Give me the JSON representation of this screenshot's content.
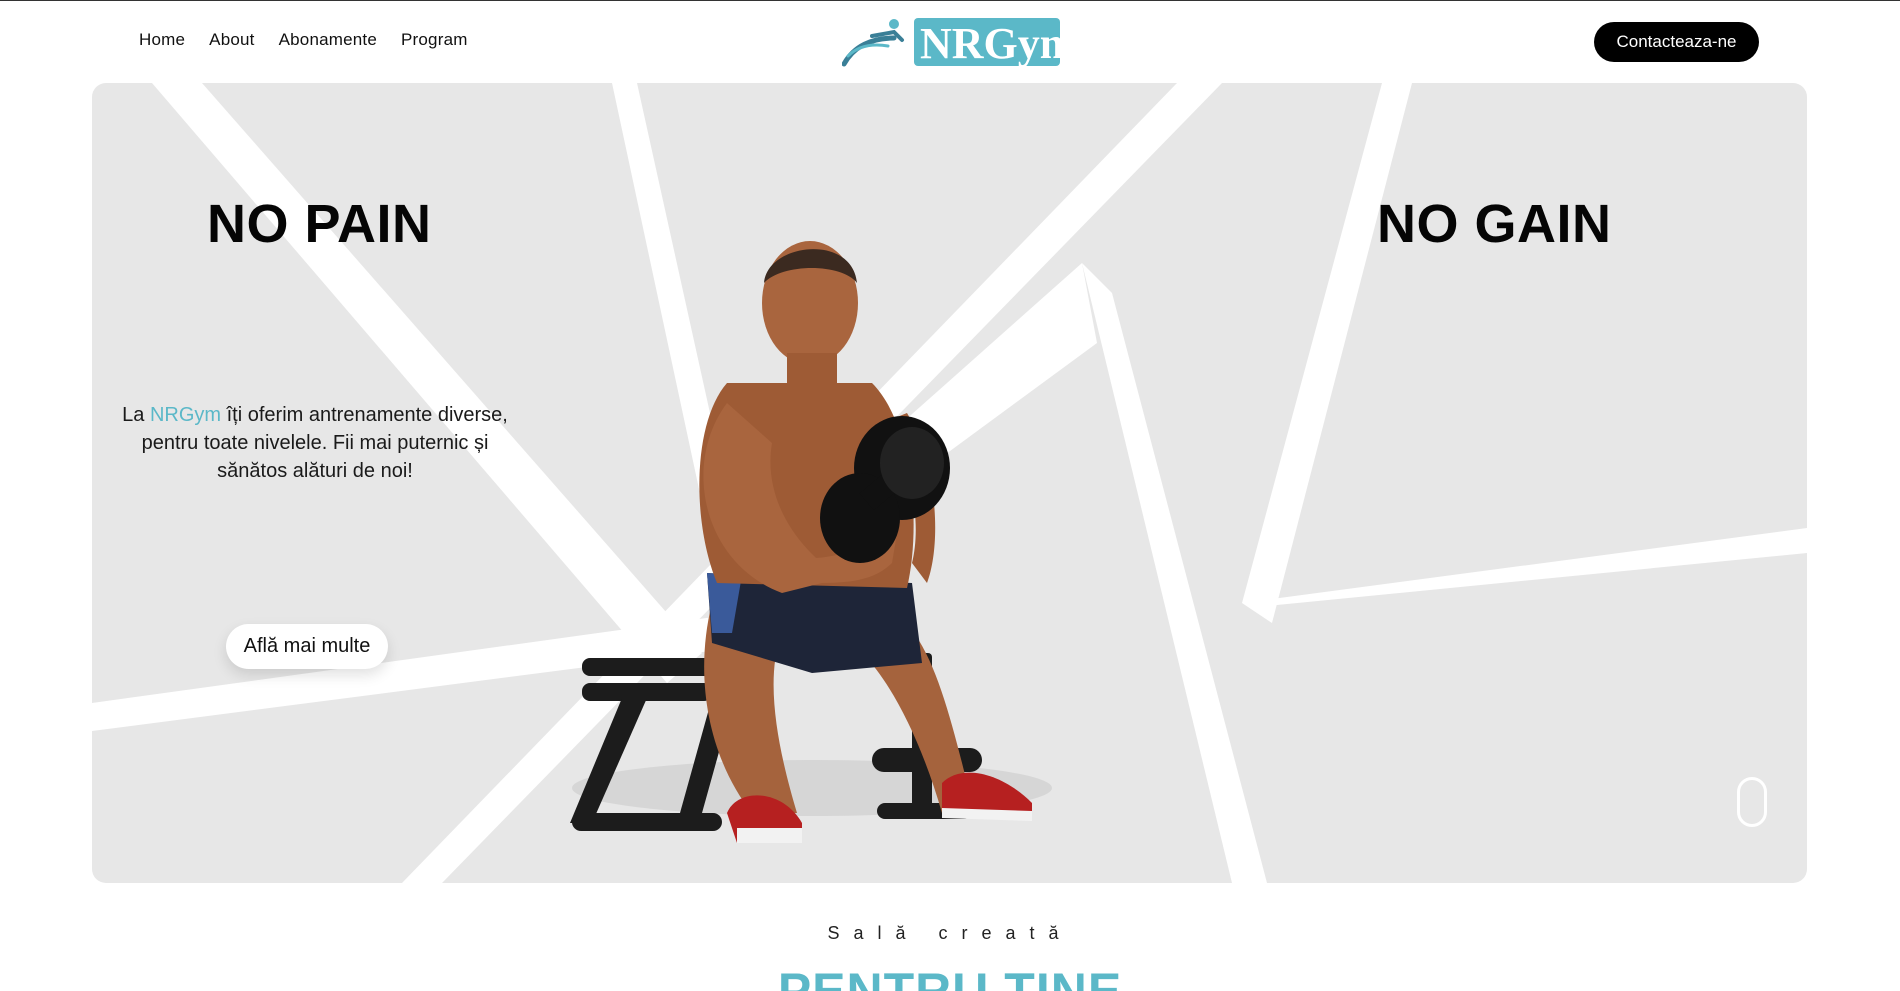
{
  "nav": {
    "links": [
      "Home",
      "About",
      "Abonamente",
      "Program"
    ],
    "logo_text": "NRGym",
    "cta_label": "Contacteaza-ne"
  },
  "hero": {
    "title_left": "NO PAIN",
    "title_right": "NO GAIN",
    "text_prefix": "La ",
    "text_brand": "NRGym",
    "text_rest": " îți oferim antrenamente diverse, pentru toate nivelele. Fii mai puternic și sănătos alături de noi!",
    "button_label": "Află mai multe"
  },
  "section": {
    "subtitle": "Sală creată",
    "headline": "PENTRU TINE"
  },
  "colors": {
    "accent": "#5bb8c8",
    "hero_bg": "#e7e7e7",
    "cta_bg": "#000000"
  },
  "icons": {
    "logo": "runner-logo-icon",
    "scroll": "scroll-mouse-icon"
  }
}
